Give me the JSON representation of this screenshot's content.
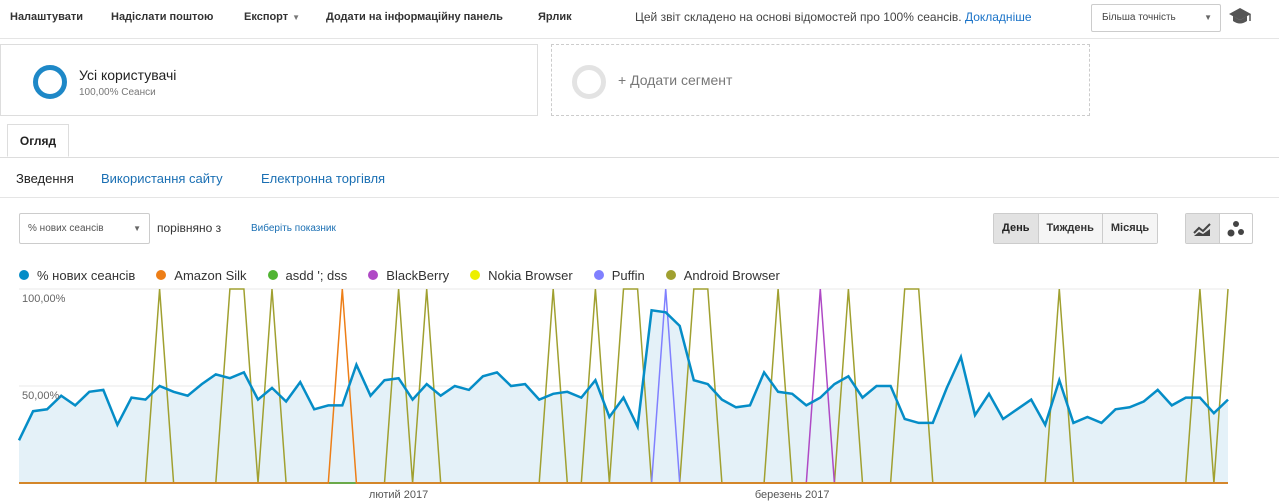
{
  "toolbar": {
    "items": [
      {
        "label": "Налаштувати"
      },
      {
        "label": "Надіслати поштою"
      },
      {
        "label": "Експорт"
      },
      {
        "label": "Додати на інформаційну панель"
      },
      {
        "label": "Ярлик"
      }
    ],
    "info_text": "Цей звіт складено на основі відомостей про 100% сеансів.",
    "info_link": "Докладніше",
    "accuracy": "Більша точність",
    "cap_icon": "graduation-cap-icon"
  },
  "segments": {
    "active": {
      "title": "Усі користувачі",
      "subtitle": "100,00% Сеанси"
    },
    "add_label": "+ Додати сегмент"
  },
  "tabs": [
    {
      "label": "Огляд"
    }
  ],
  "subnav": [
    {
      "label": "Зведення"
    },
    {
      "label": "Використання сайту"
    },
    {
      "label": "Електронна торгівля"
    }
  ],
  "controls": {
    "metric": "% нових сеансів",
    "compare": "порівняно з",
    "choose_metric": "Виберіть показник",
    "periods": [
      {
        "label": "День"
      },
      {
        "label": "Тиждень"
      },
      {
        "label": "Місяць"
      }
    ],
    "active_period": "День"
  },
  "colors": {
    "main": "#058dc7",
    "amazon": "#ed7e17",
    "asdd": "#50b432",
    "blackberry": "#af49c5",
    "nokia": "#edef00",
    "puffin": "#8080ff",
    "android": "#a0a030"
  },
  "chart_data": {
    "type": "line",
    "ylabels": [
      "100,00%",
      "50,00%"
    ],
    "ylim": [
      0,
      100
    ],
    "xlabels": [
      {
        "label": "лютий 2017",
        "index": 27
      },
      {
        "label": "березень 2017",
        "index": 55
      }
    ],
    "series": [
      {
        "name": "% нових сеансів",
        "color": "#058dc7",
        "area": true,
        "values": [
          22,
          37,
          38,
          45,
          40,
          47,
          48,
          30,
          44,
          43,
          50,
          47,
          45,
          51,
          56,
          54,
          57,
          43,
          49,
          42,
          52,
          38,
          40,
          40,
          61,
          45,
          53,
          54,
          43,
          51,
          45,
          50,
          48,
          55,
          57,
          50,
          51,
          43,
          46,
          47,
          44,
          53,
          34,
          44,
          29,
          89,
          88,
          81,
          53,
          51,
          43,
          39,
          40,
          57,
          47,
          46,
          40,
          44,
          51,
          55,
          44,
          50,
          50,
          33,
          31,
          31,
          49,
          65,
          35,
          46,
          33,
          38,
          43,
          30,
          53,
          31,
          34,
          31,
          38,
          39,
          42,
          48,
          40,
          44,
          44,
          36,
          43
        ]
      },
      {
        "name": "Amazon Silk",
        "color": "#ed7e17",
        "values": [
          0,
          0,
          0,
          0,
          0,
          0,
          0,
          0,
          0,
          0,
          0,
          0,
          0,
          0,
          0,
          0,
          0,
          0,
          0,
          0,
          0,
          0,
          0,
          100,
          0,
          0,
          0,
          0,
          0,
          0,
          0,
          0,
          0,
          0,
          0,
          0,
          0,
          0,
          0,
          0,
          0,
          0,
          0,
          0,
          0,
          0,
          0,
          0,
          0,
          0,
          0,
          0,
          0,
          0,
          0,
          0,
          0,
          0,
          0,
          0,
          0,
          0,
          0,
          0,
          0,
          0,
          0,
          0,
          0,
          0,
          0,
          0,
          0,
          0,
          0,
          0,
          0,
          0,
          0,
          0,
          0,
          0,
          0,
          0,
          0,
          0,
          0
        ]
      },
      {
        "name": "asdd '; dss",
        "color": "#50b432",
        "values": [
          0,
          0,
          0,
          0,
          0,
          0,
          0,
          0,
          0,
          0,
          0,
          0,
          0,
          0,
          0,
          0,
          0,
          0,
          0,
          0,
          0,
          0,
          0,
          0,
          0,
          0,
          0,
          0,
          0,
          0,
          0,
          0,
          0,
          0,
          0,
          0,
          0,
          0,
          0,
          0,
          0,
          0,
          0,
          0,
          0,
          0,
          0,
          0,
          0,
          0,
          0,
          0,
          0,
          0,
          0,
          0,
          0,
          0,
          0,
          0,
          0,
          0,
          0,
          0,
          0,
          0,
          0,
          0,
          0,
          0,
          0,
          0,
          0,
          0,
          0,
          0,
          0,
          0,
          0,
          0,
          0,
          0,
          0,
          0,
          0,
          0,
          0
        ]
      },
      {
        "name": "BlackBerry",
        "color": "#af49c5",
        "values": [
          0,
          0,
          0,
          0,
          0,
          0,
          0,
          0,
          0,
          0,
          0,
          0,
          0,
          0,
          0,
          0,
          0,
          0,
          0,
          0,
          0,
          0,
          0,
          0,
          0,
          0,
          0,
          0,
          0,
          0,
          0,
          0,
          0,
          0,
          0,
          0,
          0,
          0,
          0,
          0,
          0,
          0,
          0,
          0,
          0,
          0,
          0,
          0,
          0,
          0,
          0,
          0,
          0,
          0,
          0,
          0,
          0,
          100,
          0,
          0,
          0,
          0,
          0,
          0,
          0,
          0,
          0,
          0,
          0,
          0,
          0,
          0,
          0,
          0,
          0,
          0,
          0,
          0,
          0,
          0,
          0,
          0,
          0,
          0,
          0,
          0,
          0
        ]
      },
      {
        "name": "Nokia Browser",
        "color": "#edef00",
        "values": [
          0,
          0,
          0,
          0,
          0,
          0,
          0,
          0,
          0,
          0,
          0,
          0,
          0,
          0,
          0,
          0,
          0,
          0,
          0,
          0,
          0,
          0,
          0,
          0,
          0,
          0,
          0,
          0,
          0,
          0,
          0,
          0,
          0,
          0,
          0,
          0,
          0,
          0,
          0,
          0,
          0,
          0,
          0,
          0,
          0,
          0,
          0,
          0,
          0,
          0,
          0,
          0,
          0,
          0,
          0,
          0,
          0,
          0,
          0,
          0,
          0,
          0,
          0,
          0,
          0,
          0,
          0,
          0,
          0,
          0,
          0,
          0,
          0,
          0,
          0,
          0,
          0,
          0,
          0,
          0,
          0,
          0,
          0,
          0,
          0,
          0,
          0
        ]
      },
      {
        "name": "Puffin",
        "color": "#8080ff",
        "values": [
          0,
          0,
          0,
          0,
          0,
          0,
          0,
          0,
          0,
          0,
          0,
          0,
          0,
          0,
          0,
          0,
          0,
          0,
          0,
          0,
          0,
          0,
          0,
          0,
          0,
          0,
          0,
          0,
          0,
          0,
          0,
          0,
          0,
          0,
          0,
          0,
          0,
          0,
          0,
          0,
          0,
          0,
          0,
          0,
          0,
          0,
          100,
          0,
          0,
          0,
          0,
          0,
          0,
          0,
          0,
          0,
          0,
          0,
          0,
          0,
          0,
          0,
          0,
          0,
          0,
          0,
          0,
          0,
          0,
          0,
          0,
          0,
          0,
          0,
          0,
          0,
          0,
          0,
          0,
          0,
          0,
          0,
          0,
          0,
          0,
          0,
          0
        ]
      },
      {
        "name": "Android Browser",
        "color": "#a0a030",
        "values": [
          0,
          0,
          0,
          0,
          0,
          0,
          0,
          0,
          0,
          0,
          100,
          0,
          0,
          0,
          0,
          100,
          100,
          0,
          100,
          0,
          0,
          0,
          0,
          0,
          0,
          0,
          0,
          100,
          0,
          100,
          0,
          0,
          0,
          0,
          0,
          0,
          0,
          0,
          100,
          0,
          0,
          100,
          0,
          100,
          100,
          0,
          0,
          0,
          100,
          100,
          0,
          0,
          0,
          0,
          100,
          0,
          0,
          0,
          0,
          100,
          0,
          0,
          0,
          100,
          100,
          0,
          0,
          0,
          0,
          0,
          0,
          0,
          0,
          0,
          100,
          0,
          0,
          0,
          0,
          0,
          0,
          0,
          0,
          0,
          100,
          0,
          100
        ]
      }
    ]
  }
}
